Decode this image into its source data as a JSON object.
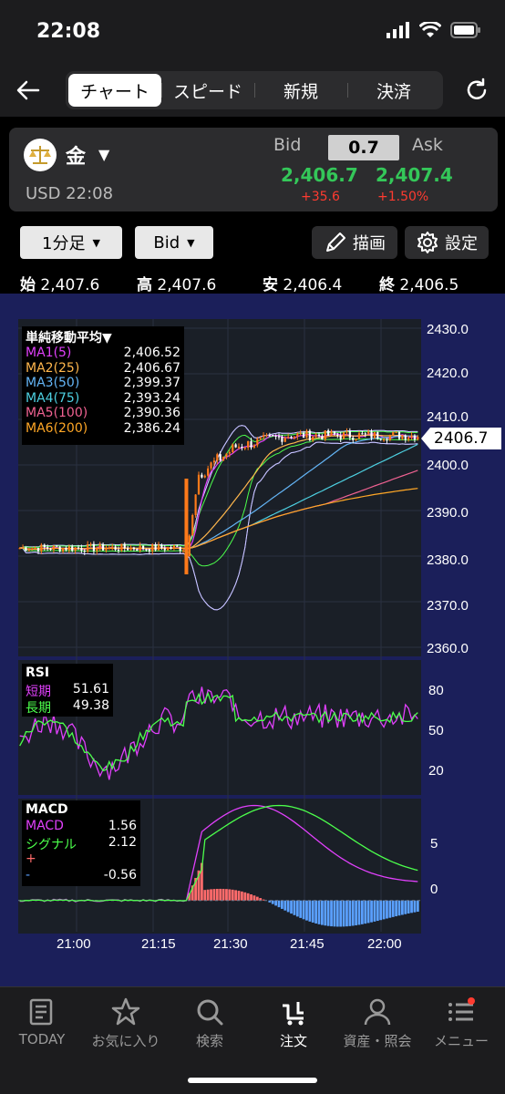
{
  "status": {
    "time": "22:08"
  },
  "nav": {
    "tabs": [
      "チャート",
      "スピード",
      "新規",
      "決済"
    ],
    "active_tab": 0
  },
  "instrument": {
    "name": "金",
    "currency_time": "USD 22:08"
  },
  "quote": {
    "bid_label": "Bid",
    "ask_label": "Ask",
    "spread": "0.7",
    "bid": "2,406.7",
    "ask": "2,407.4",
    "change": "+35.6",
    "change_pct": "+1.50%"
  },
  "controls": {
    "timeframe": "1分足",
    "price_type": "Bid",
    "draw_label": "描画",
    "settings_label": "設定"
  },
  "ohlc": [
    {
      "label": "始",
      "value": "2,407.6"
    },
    {
      "label": "高",
      "value": "2,407.6"
    },
    {
      "label": "安",
      "value": "2,406.4"
    },
    {
      "label": "終",
      "value": "2,406.5"
    }
  ],
  "ma_legend": {
    "title": "単純移動平均▼",
    "items": [
      {
        "name": "MA1(5)",
        "value": "2,406.52",
        "color": "#e040fb"
      },
      {
        "name": "MA2(25)",
        "value": "2,406.67",
        "color": "#ffb74d"
      },
      {
        "name": "MA3(50)",
        "value": "2,399.37",
        "color": "#64b5f6"
      },
      {
        "name": "MA4(75)",
        "value": "2,393.24",
        "color": "#4dd0e1"
      },
      {
        "name": "MA5(100)",
        "value": "2,390.36",
        "color": "#f06292"
      },
      {
        "name": "MA6(200)",
        "value": "2,386.24",
        "color": "#ffa726"
      }
    ]
  },
  "price_axis": [
    "2430.0",
    "2420.0",
    "2410.0",
    "2400.0",
    "2390.0",
    "2380.0",
    "2370.0",
    "2360.0"
  ],
  "last_price": "2406.7",
  "rsi": {
    "title": "RSI",
    "short_label": "短期",
    "short_value": "51.61",
    "long_label": "長期",
    "long_value": "49.38",
    "axis": [
      "80",
      "50",
      "20"
    ]
  },
  "macd": {
    "title": "MACD",
    "macd_label": "MACD",
    "macd_value": "1.56",
    "signal_label": "シグナル",
    "signal_value": "2.12",
    "plus_label": "+",
    "minus_label": "-",
    "hist_value": "-0.56",
    "axis": [
      "5",
      "0"
    ]
  },
  "time_axis": [
    "21:00",
    "21:15",
    "21:30",
    "21:45",
    "22:00"
  ],
  "tab_bar": [
    {
      "label": "TODAY",
      "icon": "newspaper-icon"
    },
    {
      "label": "お気に入り",
      "icon": "star-icon"
    },
    {
      "label": "検索",
      "icon": "search-icon"
    },
    {
      "label": "注文",
      "icon": "cart-icon"
    },
    {
      "label": "資産・照会",
      "icon": "person-icon"
    },
    {
      "label": "メニュー",
      "icon": "menu-icon"
    }
  ],
  "chart_data": {
    "type": "candlestick",
    "x_labels": [
      "21:00",
      "21:15",
      "21:30",
      "21:45",
      "22:00"
    ],
    "ylim": [
      2358,
      2432
    ],
    "rsi_ylim": [
      0,
      100
    ],
    "macd_ylim": [
      -2.5,
      8
    ]
  }
}
